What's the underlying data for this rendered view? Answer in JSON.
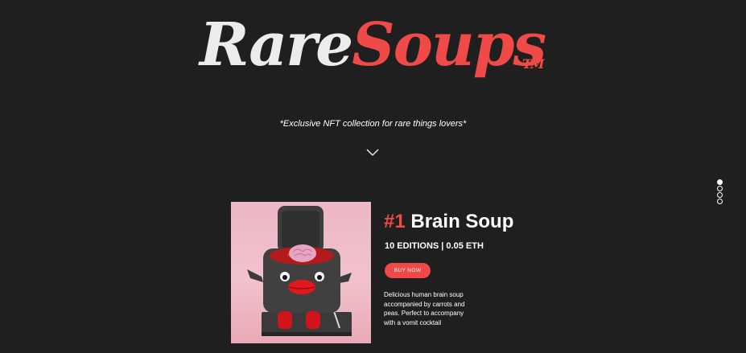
{
  "brand": {
    "logo_part1": "Rare",
    "logo_part2": "Soups",
    "trademark": "TM",
    "accent_color": "#ef4a47",
    "background_color": "#1f1f1f"
  },
  "hero": {
    "tagline": "*Exclusive NFT collection for rare things lovers*",
    "scroll_icon": "chevron-down-icon"
  },
  "pagination": {
    "count": 4,
    "active_index": 0
  },
  "product": {
    "number": "#1",
    "name": "Brain Soup",
    "meta": "10 EDITIONS | 0.05 ETH",
    "buy_label": "BUY NOW",
    "description": "Delicious human brain soup accompanied by carrots and peas. Perfect to accompany with a vomit cocktail",
    "image_label": "brain-soup-character-illustration"
  }
}
